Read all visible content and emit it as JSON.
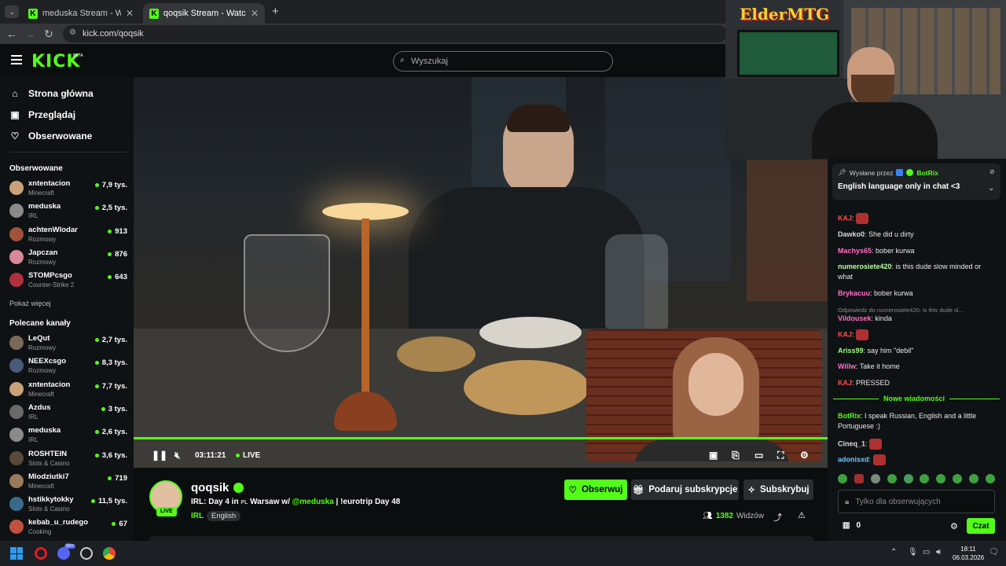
{
  "browser": {
    "tabs": [
      {
        "title": "meduska Stream - Watch Live o"
      },
      {
        "title": "qoqsik Stream - Watch Live on"
      }
    ],
    "new_tab": "+",
    "url": "kick.com/qoqsik"
  },
  "header": {
    "logo": "KICK",
    "beta": "BETA",
    "search_placeholder": "Wyszukaj"
  },
  "sidebar": {
    "nav": [
      {
        "label": "Strona główna",
        "icon": "home-icon"
      },
      {
        "label": "Przeglądaj",
        "icon": "browse-icon"
      },
      {
        "label": "Obserwowane",
        "icon": "heart-icon"
      }
    ],
    "followed_title": "Obserwowane",
    "followed": [
      {
        "name": "xntentacion",
        "category": "Minecraft",
        "viewers": "7,9 tys.",
        "color": "#c9a27a"
      },
      {
        "name": "meduska",
        "category": "IRL",
        "viewers": "2,5 tys.",
        "color": "#8a8a8a"
      },
      {
        "name": "achtenWlodar",
        "category": "Rozmowy",
        "viewers": "913",
        "color": "#a0523a"
      },
      {
        "name": "Japczan",
        "category": "Rozmowy",
        "viewers": "876",
        "color": "#d98a9a"
      },
      {
        "name": "STOMPcsgo",
        "category": "Counter-Strike 2",
        "viewers": "643",
        "color": "#b03040"
      }
    ],
    "show_more": "Pokaż więcej",
    "recommended_title": "Polecane kanały",
    "recommended": [
      {
        "name": "LeQut",
        "category": "Rozmowy",
        "viewers": "2,7 tys.",
        "color": "#7a6a5a"
      },
      {
        "name": "NEEXcsgo",
        "category": "Rozmowy",
        "viewers": "8,3 tys.",
        "color": "#4a5a7a"
      },
      {
        "name": "xntentacion",
        "category": "Minecraft",
        "viewers": "7,7 tys.",
        "color": "#c9a27a"
      },
      {
        "name": "Azdus",
        "category": "IRL",
        "viewers": "3 tys.",
        "color": "#6a6a6a"
      },
      {
        "name": "meduska",
        "category": "IRL",
        "viewers": "2,6 tys.",
        "color": "#8a8a8a"
      },
      {
        "name": "ROSHTEIN",
        "category": "Slots & Casino",
        "viewers": "3,6 tys.",
        "color": "#5a4a3a"
      },
      {
        "name": "Mlodziutki7",
        "category": "Minecraft",
        "viewers": "719",
        "color": "#9a7a5a"
      },
      {
        "name": "hstikkytokky",
        "category": "Slots & Casino",
        "viewers": "11,5 tys.",
        "color": "#3a6a8a"
      },
      {
        "name": "kebab_u_rudego",
        "category": "Cooking",
        "viewers": "67",
        "color": "#c05040"
      }
    ]
  },
  "player": {
    "time": "03:11:21",
    "live_label": "LIVE"
  },
  "overlay": {
    "elder_logo": "ElderMTG"
  },
  "stream": {
    "channel": "qoqsik",
    "live_badge": "LIVE",
    "title_prefix": "IRL: Day 4 in ",
    "flag": "PL",
    "title_city": " Warsaw w/ ",
    "mention": "@meduska",
    "title_suffix": " | !eurotrip Day 48",
    "tags": [
      "IRL",
      "English"
    ],
    "follow_label": "Obserwuj",
    "gift_label": "Podaruj subskrypcje",
    "subscribe_label": "Subskrybuj",
    "viewers_count": "1382",
    "viewers_label": "Widzów"
  },
  "chat": {
    "pinned_by_label": "Wysłane przez",
    "pinned_by": "BotRix",
    "pinned_text": "English language only in chat <3",
    "messages": [
      {
        "user": "KAJ",
        "text": "",
        "emote": true,
        "color": "#ff4d4d"
      },
      {
        "user": "Dawko0",
        "text": "She did u dirty",
        "color": "#d9d9d9"
      },
      {
        "user": "Machys65",
        "text": "bober kurwa",
        "color": "#ff6ec7"
      },
      {
        "user": "numerosiete420",
        "text": "is this dude slow minded or what",
        "color": "#b6ff9e"
      },
      {
        "user": "Brykacuu",
        "text": "bober kurwa",
        "color": "#ff6ec7"
      },
      {
        "user": "Vildousek",
        "text": "kinda",
        "color": "#ff6ec7",
        "reply": "Odpowiedz do numerosiete420: is this dude sl..."
      },
      {
        "user": "KAJ",
        "text": "",
        "emote": true,
        "color": "#ff4d4d"
      },
      {
        "user": "Ariss99",
        "text": "say him \"debil\"",
        "color": "#9eff7a"
      },
      {
        "user": "Willw",
        "text": "Take it home",
        "color": "#ff6ec7"
      },
      {
        "user": "KAJ",
        "text": "PRESSED",
        "color": "#ff4d4d"
      }
    ],
    "new_messages": "Nowe wiadomości",
    "after": [
      {
        "user": "BotRix",
        "text": "I speak Russian, English and a little Portuguese :)",
        "color": "#53fc18"
      },
      {
        "user": "Cineq_1",
        "text": "",
        "emote": true,
        "color": "#d9d9d9"
      },
      {
        "user": "adonisxd",
        "text": "",
        "emote": true,
        "color": "#6ecbff"
      }
    ],
    "input_placeholder": "Tylko dla obserwujących",
    "points": "0",
    "send_label": "Czat"
  },
  "taskbar": {
    "time": "18:11",
    "date": "06.03.2026",
    "discord_badge": "99+"
  }
}
